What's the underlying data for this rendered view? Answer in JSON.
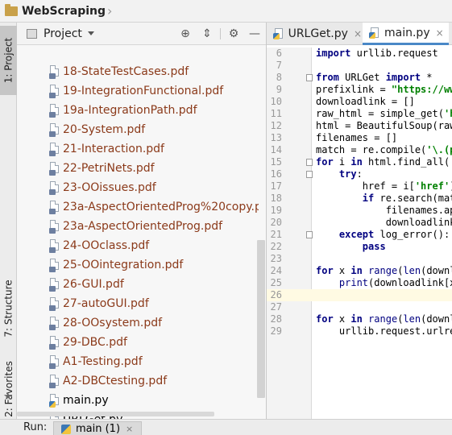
{
  "navbar": {
    "project_name": "WebScraping",
    "chevron": "›"
  },
  "left_stripe": {
    "project_tab": "1: Project",
    "structure_tab": "7: Structure",
    "favorites_tab": "2: Favorites",
    "star_icon": "★"
  },
  "project_panel": {
    "title": "Project",
    "toolbar": {
      "locate_icon": "⊕",
      "collapse_icon": "⇕",
      "settings_icon": "⚙",
      "hide_icon": "—"
    },
    "files": [
      {
        "name": "18-StateTestCases.pdf",
        "kind": "pdf"
      },
      {
        "name": "19-IntegrationFunctional.pdf",
        "kind": "pdf"
      },
      {
        "name": "19a-IntegrationPath.pdf",
        "kind": "pdf"
      },
      {
        "name": "20-System.pdf",
        "kind": "pdf"
      },
      {
        "name": "21-Interaction.pdf",
        "kind": "pdf"
      },
      {
        "name": "22-PetriNets.pdf",
        "kind": "pdf"
      },
      {
        "name": "23-OOissues.pdf",
        "kind": "pdf"
      },
      {
        "name": "23a-AspectOrientedProg%20copy.pdf",
        "kind": "pdf"
      },
      {
        "name": "23a-AspectOrientedProg.pdf",
        "kind": "pdf"
      },
      {
        "name": "24-OOclass.pdf",
        "kind": "pdf"
      },
      {
        "name": "25-OOintegration.pdf",
        "kind": "pdf"
      },
      {
        "name": "26-GUI.pdf",
        "kind": "pdf"
      },
      {
        "name": "27-autoGUI.pdf",
        "kind": "pdf"
      },
      {
        "name": "28-OOsystem.pdf",
        "kind": "pdf"
      },
      {
        "name": "29-DBC.pdf",
        "kind": "pdf"
      },
      {
        "name": "A1-Testing.pdf",
        "kind": "pdf"
      },
      {
        "name": "A2-DBCtesting.pdf",
        "kind": "pdf"
      },
      {
        "name": "main.py",
        "kind": "py"
      },
      {
        "name": "URLGet.py",
        "kind": "py"
      }
    ]
  },
  "editor": {
    "tabs": [
      {
        "label": "URLGet.py",
        "close": "×",
        "active": false
      },
      {
        "label": "main.py",
        "close": "×",
        "active": true
      }
    ],
    "current_line": "26",
    "lines": [
      {
        "n": "6",
        "code": "import urllib.request"
      },
      {
        "n": "7",
        "code": ""
      },
      {
        "n": "8",
        "code": "from URLGet import *"
      },
      {
        "n": "9",
        "code": "prefixlink = \"https://www"
      },
      {
        "n": "10",
        "code": "downloadlink = []"
      },
      {
        "n": "11",
        "code": "raw_html = simple_get('h"
      },
      {
        "n": "12",
        "code": "html = BeautifulSoup(raw"
      },
      {
        "n": "13",
        "code": "filenames = []"
      },
      {
        "n": "14",
        "code": "match = re.compile('\\.(p"
      },
      {
        "n": "15",
        "code": "for i in html.find_all('"
      },
      {
        "n": "16",
        "code": "    try:"
      },
      {
        "n": "17",
        "code": "        href = i['href']"
      },
      {
        "n": "18",
        "code": "        if re.search(mat"
      },
      {
        "n": "19",
        "code": "            filenames.ap"
      },
      {
        "n": "20",
        "code": "            downloadlink"
      },
      {
        "n": "21",
        "code": "    except log_error():"
      },
      {
        "n": "22",
        "code": "        pass"
      },
      {
        "n": "23",
        "code": ""
      },
      {
        "n": "24",
        "code": "for x in range(len(downlo"
      },
      {
        "n": "25",
        "code": "    print(downloadlink[x"
      },
      {
        "n": "26",
        "code": ""
      },
      {
        "n": "27",
        "code": ""
      },
      {
        "n": "28",
        "code": "for x in range(len(downlo"
      },
      {
        "n": "29",
        "code": "    urllib.request.urlre"
      }
    ]
  },
  "run_bar": {
    "label": "Run:",
    "tab_label": "main (1)",
    "close": "×"
  },
  "colors": {
    "keyword": "#000080",
    "string": "#008000",
    "pdf_file": "#8b3a1a",
    "current_line_bg": "#fffae3",
    "tab_underline": "#4a88c7"
  }
}
